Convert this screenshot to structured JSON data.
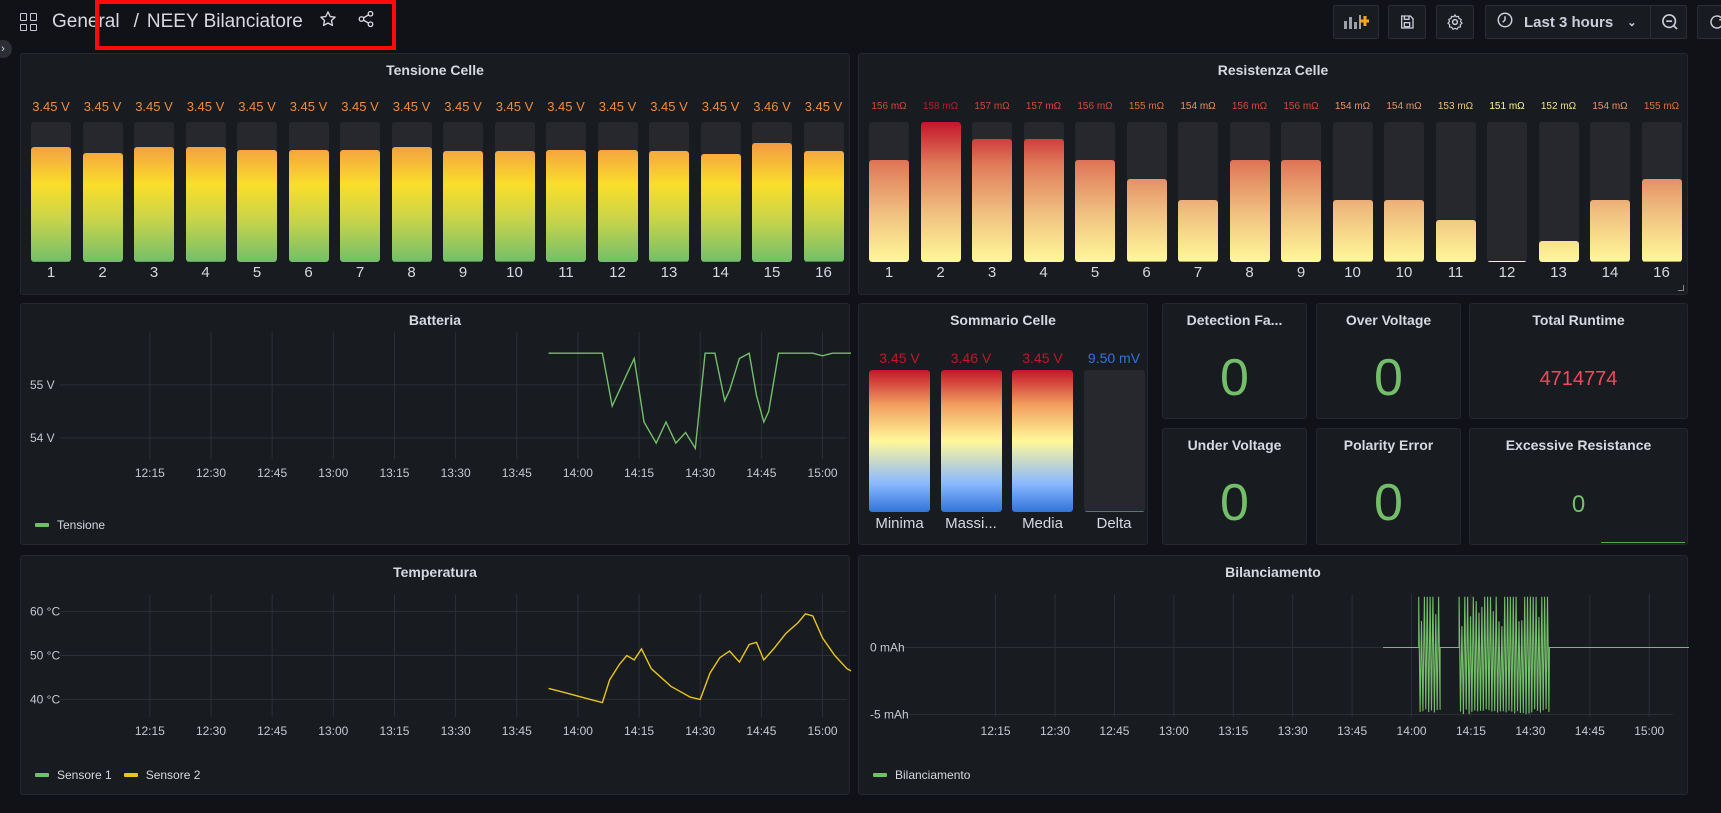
{
  "header": {
    "breadcrumb_root": "General",
    "breadcrumb_sep": "/",
    "dashboard_title": "NEEY Bilanciatore",
    "time_range": "Last 3 hours"
  },
  "colors": {
    "green": "#73bf69",
    "yellow": "#e8c51a",
    "red": "#f2495c",
    "orange": "#f08c3a",
    "blue": "#3274d9",
    "highlight_box": "#ff0a0a"
  },
  "panels": {
    "tensione_celle": {
      "title": "Tensione Celle",
      "cells": [
        {
          "label": "1",
          "value": "3.45 V",
          "fill": 0.82
        },
        {
          "label": "2",
          "value": "3.45 V",
          "fill": 0.78
        },
        {
          "label": "3",
          "value": "3.45 V",
          "fill": 0.82
        },
        {
          "label": "4",
          "value": "3.45 V",
          "fill": 0.82
        },
        {
          "label": "5",
          "value": "3.45 V",
          "fill": 0.8
        },
        {
          "label": "6",
          "value": "3.45 V",
          "fill": 0.8
        },
        {
          "label": "7",
          "value": "3.45 V",
          "fill": 0.8
        },
        {
          "label": "8",
          "value": "3.45 V",
          "fill": 0.82
        },
        {
          "label": "9",
          "value": "3.45 V",
          "fill": 0.79
        },
        {
          "label": "10",
          "value": "3.45 V",
          "fill": 0.79
        },
        {
          "label": "11",
          "value": "3.45 V",
          "fill": 0.8
        },
        {
          "label": "12",
          "value": "3.45 V",
          "fill": 0.8
        },
        {
          "label": "13",
          "value": "3.45 V",
          "fill": 0.79
        },
        {
          "label": "14",
          "value": "3.45 V",
          "fill": 0.77
        },
        {
          "label": "15",
          "value": "3.46 V",
          "fill": 0.85
        },
        {
          "label": "16",
          "value": "3.45 V",
          "fill": 0.79
        }
      ]
    },
    "resistenza_celle": {
      "title": "Resistenza Celle",
      "cells": [
        {
          "label": "1",
          "value": "156 mΩ",
          "fill": 0.73,
          "color": "#d44a3a"
        },
        {
          "label": "2",
          "value": "158 mΩ",
          "fill": 1.0,
          "color": "#c4162a"
        },
        {
          "label": "3",
          "value": "157 mΩ",
          "fill": 0.88,
          "color": "#d44a3a"
        },
        {
          "label": "4",
          "value": "157 mΩ",
          "fill": 0.88,
          "color": "#d44a3a"
        },
        {
          "label": "5",
          "value": "156 mΩ",
          "fill": 0.73,
          "color": "#d44a3a"
        },
        {
          "label": "6",
          "value": "155 mΩ",
          "fill": 0.59,
          "color": "#e0703a"
        },
        {
          "label": "7",
          "value": "154 mΩ",
          "fill": 0.44,
          "color": "#e8966a"
        },
        {
          "label": "8",
          "value": "156 mΩ",
          "fill": 0.73,
          "color": "#d44a3a"
        },
        {
          "label": "9",
          "value": "156 mΩ",
          "fill": 0.73,
          "color": "#d44a3a"
        },
        {
          "label": "10",
          "value": "154 mΩ",
          "fill": 0.44,
          "color": "#e8966a"
        },
        {
          "label": "10",
          "value": "154 mΩ",
          "fill": 0.44,
          "color": "#e8966a"
        },
        {
          "label": "11",
          "value": "153 mΩ",
          "fill": 0.3,
          "color": "#eec27a"
        },
        {
          "label": "12",
          "value": "151 mΩ",
          "fill": 0.01,
          "color": "#fff899"
        },
        {
          "label": "13",
          "value": "152 mΩ",
          "fill": 0.15,
          "color": "#f5e08a"
        },
        {
          "label": "14",
          "value": "154 mΩ",
          "fill": 0.44,
          "color": "#e8966a"
        },
        {
          "label": "16",
          "value": "155 mΩ",
          "fill": 0.59,
          "color": "#e0703a"
        }
      ]
    },
    "batteria": {
      "title": "Batteria",
      "legend": [
        {
          "name": "Tensione",
          "color": "#73bf69"
        }
      ]
    },
    "sommario_celle": {
      "title": "Sommario Celle",
      "items": [
        {
          "label": "Minima",
          "value": "3.45 V",
          "fill": 1.0,
          "value_color": "#c4162a"
        },
        {
          "label": "Massi...",
          "value": "3.46 V",
          "fill": 1.0,
          "value_color": "#c4162a"
        },
        {
          "label": "Media",
          "value": "3.45 V",
          "fill": 1.0,
          "value_color": "#c4162a"
        },
        {
          "label": "Delta",
          "value": "9.50 mV",
          "fill": 0.01,
          "value_color": "#3274d9"
        }
      ]
    },
    "detection_failure": {
      "title": "Detection Fa...",
      "value": "0"
    },
    "over_voltage": {
      "title": "Over Voltage",
      "value": "0"
    },
    "total_runtime": {
      "title": "Total Runtime",
      "value": "4714774"
    },
    "under_voltage": {
      "title": "Under Voltage",
      "value": "0"
    },
    "polarity_error": {
      "title": "Polarity Error",
      "value": "0"
    },
    "excessive_resistance": {
      "title": "Excessive Resistance",
      "value": "0"
    },
    "temperatura": {
      "title": "Temperatura",
      "legend": [
        {
          "name": "Sensore 1",
          "color": "#73bf69"
        },
        {
          "name": "Sensore 2",
          "color": "#e8c51a"
        }
      ]
    },
    "bilanciamento": {
      "title": "Bilanciamento",
      "legend": [
        {
          "name": "Bilanciamento",
          "color": "#73bf69"
        }
      ]
    }
  },
  "chart_data": [
    {
      "type": "line",
      "title": "Batteria",
      "x": [
        "12:15",
        "12:30",
        "12:45",
        "13:00",
        "13:15",
        "13:30",
        "13:45",
        "14:00",
        "14:15",
        "14:30",
        "14:45",
        "15:00"
      ],
      "yticks": [
        "55 V",
        "54 V"
      ],
      "ylim": [
        53.6,
        56.0
      ],
      "series": [
        {
          "name": "Tensione",
          "color": "#73bf69",
          "points": [
            [
              13.88,
              55.6
            ],
            [
              13.95,
              55.6
            ],
            [
              14.05,
              55.6
            ],
            [
              14.1,
              55.6
            ],
            [
              14.14,
              54.6
            ],
            [
              14.2,
              55.2
            ],
            [
              14.23,
              55.5
            ],
            [
              14.27,
              54.3
            ],
            [
              14.32,
              53.9
            ],
            [
              14.36,
              54.3
            ],
            [
              14.4,
              53.9
            ],
            [
              14.44,
              54.1
            ],
            [
              14.48,
              53.8
            ],
            [
              14.52,
              55.6
            ],
            [
              14.56,
              55.6
            ],
            [
              14.6,
              54.7
            ],
            [
              14.62,
              54.9
            ],
            [
              14.66,
              55.5
            ],
            [
              14.7,
              55.6
            ],
            [
              14.73,
              54.8
            ],
            [
              14.76,
              54.3
            ],
            [
              14.78,
              54.5
            ],
            [
              14.82,
              55.6
            ],
            [
              14.9,
              55.6
            ],
            [
              14.96,
              55.6
            ],
            [
              15.0,
              55.55
            ],
            [
              15.04,
              55.6
            ],
            [
              15.1,
              55.6
            ],
            [
              15.2,
              55.6
            ],
            [
              15.25,
              55.6
            ],
            [
              15.3,
              55.5
            ],
            [
              15.33,
              55.5
            ],
            [
              15.36,
              55.3
            ],
            [
              15.4,
              55.5
            ],
            [
              15.46,
              55.5
            ],
            [
              15.5,
              55.3
            ]
          ]
        }
      ]
    },
    {
      "type": "line",
      "title": "Temperatura",
      "x": [
        "12:15",
        "12:30",
        "12:45",
        "13:00",
        "13:15",
        "13:30",
        "13:45",
        "14:00",
        "14:15",
        "14:30",
        "14:45",
        "15:00"
      ],
      "yticks": [
        "60 °C",
        "50 °C",
        "40 °C"
      ],
      "ylim": [
        36,
        64
      ],
      "series": [
        {
          "name": "Sensore 1",
          "color": "#73bf69",
          "points": []
        },
        {
          "name": "Sensore 2",
          "color": "#e8c51a",
          "points": [
            [
              13.88,
              42.5
            ],
            [
              13.95,
              41.5
            ],
            [
              14.05,
              40.0
            ],
            [
              14.1,
              39.3
            ],
            [
              14.13,
              44.5
            ],
            [
              14.17,
              48.0
            ],
            [
              14.2,
              50.0
            ],
            [
              14.23,
              49.0
            ],
            [
              14.26,
              51.5
            ],
            [
              14.3,
              47.0
            ],
            [
              14.38,
              43.0
            ],
            [
              14.46,
              40.5
            ],
            [
              14.5,
              40.0
            ],
            [
              14.54,
              46.0
            ],
            [
              14.58,
              49.5
            ],
            [
              14.62,
              51.0
            ],
            [
              14.66,
              48.5
            ],
            [
              14.7,
              52.5
            ],
            [
              14.73,
              53.0
            ],
            [
              14.76,
              49.0
            ],
            [
              14.8,
              51.5
            ],
            [
              14.85,
              55.0
            ],
            [
              14.9,
              57.5
            ],
            [
              14.93,
              59.5
            ],
            [
              14.96,
              59.0
            ],
            [
              15.0,
              54.0
            ],
            [
              15.05,
              50.0
            ],
            [
              15.1,
              47.0
            ],
            [
              15.2,
              44.0
            ],
            [
              15.3,
              42.0
            ],
            [
              15.4,
              40.5
            ],
            [
              15.5,
              39.0
            ],
            [
              15.6,
              38.3
            ],
            [
              15.7,
              37.8
            ],
            [
              15.78,
              37.5
            ]
          ]
        }
      ]
    },
    {
      "type": "line",
      "title": "Bilanciamento",
      "x": [
        "12:15",
        "12:30",
        "12:45",
        "13:00",
        "13:15",
        "13:30",
        "13:45",
        "14:00",
        "14:15",
        "14:30",
        "14:45",
        "15:00"
      ],
      "yticks": [
        "0 mAh",
        "-5 mAh"
      ],
      "ylim": [
        -5.2,
        4.0
      ],
      "series": [
        {
          "name": "Bilanciamento",
          "color": "#73bf69",
          "segments": [
            [
              13.88,
              14.03,
              0
            ],
            [
              14.03,
              14.12,
              "osc"
            ],
            [
              14.12,
              14.2,
              0
            ],
            [
              14.2,
              14.58,
              "osc"
            ],
            [
              14.58,
              15.58,
              0
            ]
          ]
        }
      ]
    }
  ]
}
